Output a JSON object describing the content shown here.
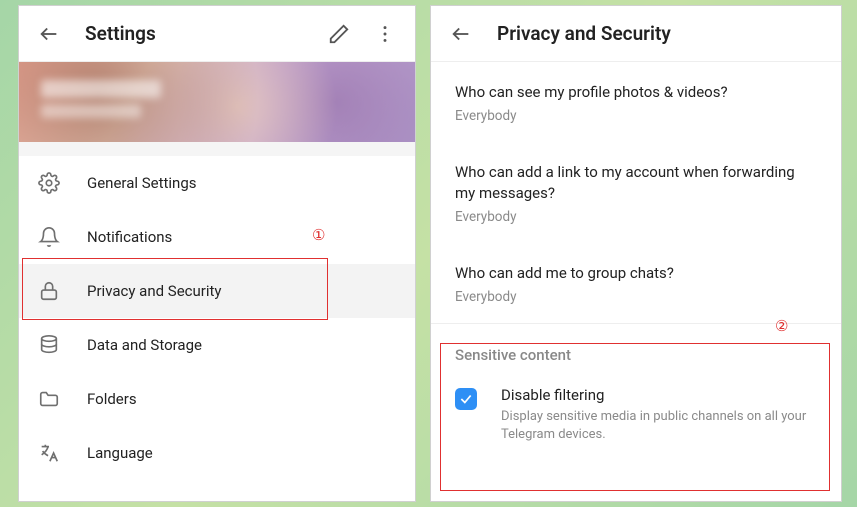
{
  "leftPanel": {
    "title": "Settings",
    "menu": [
      {
        "label": "General Settings",
        "icon": "gear-icon"
      },
      {
        "label": "Notifications",
        "icon": "bell-icon"
      },
      {
        "label": "Privacy and Security",
        "icon": "lock-icon",
        "selected": true
      },
      {
        "label": "Data and Storage",
        "icon": "database-icon"
      },
      {
        "label": "Folders",
        "icon": "folder-icon"
      },
      {
        "label": "Language",
        "icon": "language-icon"
      }
    ]
  },
  "rightPanel": {
    "title": "Privacy and Security",
    "rows": [
      {
        "title": "Who can see my profile photos & videos?",
        "value": "Everybody"
      },
      {
        "title": "Who can add a link to my account when forwarding my messages?",
        "value": "Everybody"
      },
      {
        "title": "Who can add me to group chats?",
        "value": "Everybody"
      }
    ],
    "sectionTitle": "Sensitive content",
    "toggle": {
      "checked": true,
      "title": "Disable filtering",
      "desc": "Display sensitive media in public channels on all your Telegram devices."
    }
  },
  "annotations": {
    "one": "①",
    "two": "②"
  }
}
